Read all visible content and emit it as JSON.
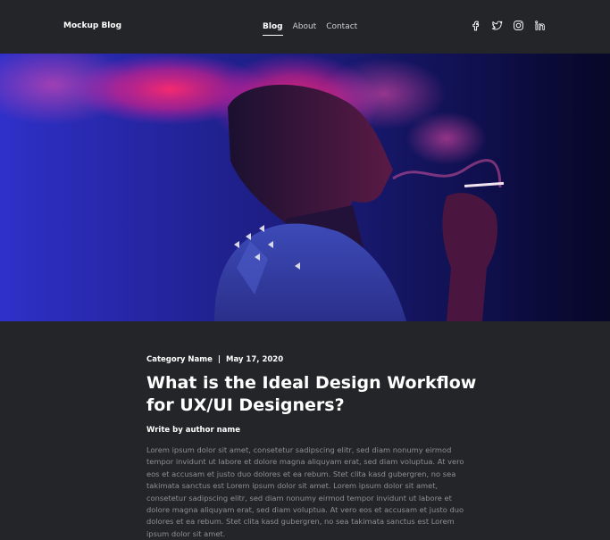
{
  "nav": {
    "brand": "Mockup Blog",
    "links": [
      {
        "label": "Blog",
        "active": true
      },
      {
        "label": "About",
        "active": false
      },
      {
        "label": "Contact",
        "active": false
      }
    ],
    "social": [
      "facebook-icon",
      "twitter-icon",
      "instagram-icon",
      "linkedin-icon"
    ]
  },
  "hero": {
    "image": "photo of person in denim jacket smoking, pink smoke hair, blue background"
  },
  "article": {
    "category": "Category Name",
    "separator": "|",
    "date": "May 17, 2020",
    "title": "What is the Ideal Design Workflow for UX/UI Designers?",
    "author": "Write by author name",
    "body": "Lorem ipsum dolor sit amet, consetetur sadipscing elitr, sed diam nonumy eirmod tempor invidunt ut labore et dolore magna aliquyam erat, sed diam voluptua. At vero eos et accusam et justo duo dolores et ea rebum. Stet clita kasd gubergren, no sea takimata sanctus est Lorem ipsum dolor sit amet. Lorem ipsum dolor sit amet, consetetur sadipscing elitr, sed diam nonumy eirmod tempor invidunt ut labore et dolore magna aliquyam erat, sed diam voluptua. At vero eos et accusam et justo duo dolores et ea rebum. Stet clita kasd gubergren, no sea takimata sanctus est Lorem ipsum dolor sit amet."
  },
  "colors": {
    "background": "#242528",
    "text": "#ffffff",
    "muted": "#8d8f96",
    "hero_blue": "#2a2bbd",
    "hero_pink": "#ff2a6d"
  }
}
